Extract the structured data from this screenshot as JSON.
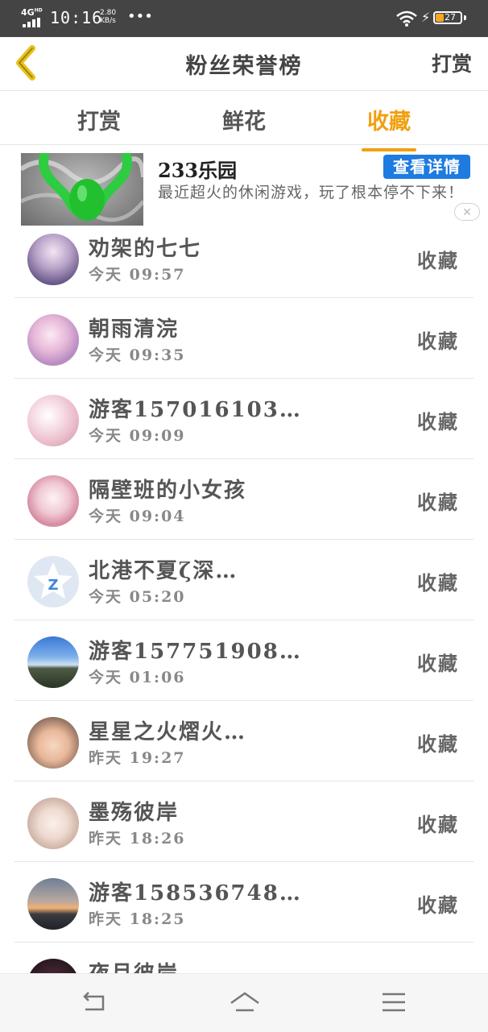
{
  "status_bar": {
    "network": "4G",
    "network_sup": "HD",
    "time": "10:16",
    "speed_value": "2.80",
    "speed_unit": "KB/s",
    "dots": "•••",
    "battery_level": "27"
  },
  "header": {
    "title": "粉丝荣誉榜",
    "right_action": "打赏"
  },
  "tabs": [
    {
      "label": "打赏",
      "active": false
    },
    {
      "label": "鲜花",
      "active": false
    },
    {
      "label": "收藏",
      "active": true
    }
  ],
  "ad": {
    "title": "233乐园",
    "button": "查看详情",
    "description": "最近超火的休闲游戏，玩了根本停不下来！",
    "close": "✕"
  },
  "list": [
    {
      "name": "劝架的七七",
      "time": "今天 09:57",
      "action": "收藏",
      "avatar": "anime-girl-purple"
    },
    {
      "name": "朝雨清浣",
      "time": "今天 09:35",
      "action": "收藏",
      "avatar": "anime-girl-pink"
    },
    {
      "name": "游客157016103…",
      "time": "今天 09:09",
      "action": "收藏",
      "avatar": "blossoms"
    },
    {
      "name": "隔壁班的小女孩",
      "time": "今天 09:04",
      "action": "收藏",
      "avatar": "anime-girl-sketch"
    },
    {
      "name": "北港不夏ζ深…",
      "time": "今天 05:20",
      "action": "收藏",
      "avatar": "qq-default"
    },
    {
      "name": "游客157751908…",
      "time": "今天 01:06",
      "action": "收藏",
      "avatar": "mountain-sky"
    },
    {
      "name": "星星之火熠火…",
      "time": "昨天 19:27",
      "action": "收藏",
      "avatar": "baby-photo"
    },
    {
      "name": "墨殇彼岸",
      "time": "昨天 18:26",
      "action": "收藏",
      "avatar": "anime-girl-light"
    },
    {
      "name": "游客158536748…",
      "time": "昨天 18:25",
      "action": "收藏",
      "avatar": "sunset"
    },
    {
      "name": "夜月彼岸",
      "time": "",
      "action": "",
      "avatar": "dark-photo"
    }
  ],
  "colors": {
    "accent": "#f0a010",
    "ad_button": "#1e7be0",
    "status_bar": "#444444"
  }
}
